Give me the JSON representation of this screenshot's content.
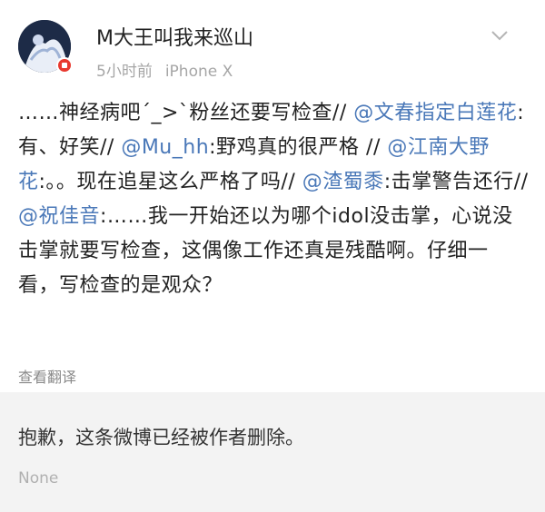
{
  "post": {
    "username": "M大王叫我来巡山",
    "time": "5小时前",
    "device": "iPhone X",
    "content_segments": [
      {
        "text": "……神经病吧ˊ_>ˋ粉丝还要写检查// ",
        "type": "text"
      },
      {
        "text": "@文春指定白莲花",
        "type": "mention"
      },
      {
        "text": ":有、好笑// ",
        "type": "text"
      },
      {
        "text": "@Mu_hh",
        "type": "mention"
      },
      {
        "text": ":野鸡真的很严格 // ",
        "type": "text"
      },
      {
        "text": "@江南大野花",
        "type": "mention"
      },
      {
        "text": ":。。现在追星这么严格了吗// ",
        "type": "text"
      },
      {
        "text": "@渣蜀黍",
        "type": "mention"
      },
      {
        "text": ":击掌警告还行// ",
        "type": "text"
      },
      {
        "text": "@祝佳音",
        "type": "mention"
      },
      {
        "text": ":……我一开始还以为哪个idol没击掌，心说没击掌就要写检查，这偶像工作还真是残酷啊。仔细一看，写检查的是观众？",
        "type": "text"
      }
    ],
    "translate_label": "查看翻译"
  },
  "retweet": {
    "deleted_text": "抱歉，这条微博已经被作者删除。",
    "meta": "None"
  },
  "colors": {
    "mention": "#4a78b8",
    "badge": "#e8392f",
    "deleted_bg": "#f3f3f3"
  },
  "icons": {
    "avatar": "avatar-image",
    "badge": "verified-badge-icon",
    "chevron": "chevron-down-icon"
  }
}
